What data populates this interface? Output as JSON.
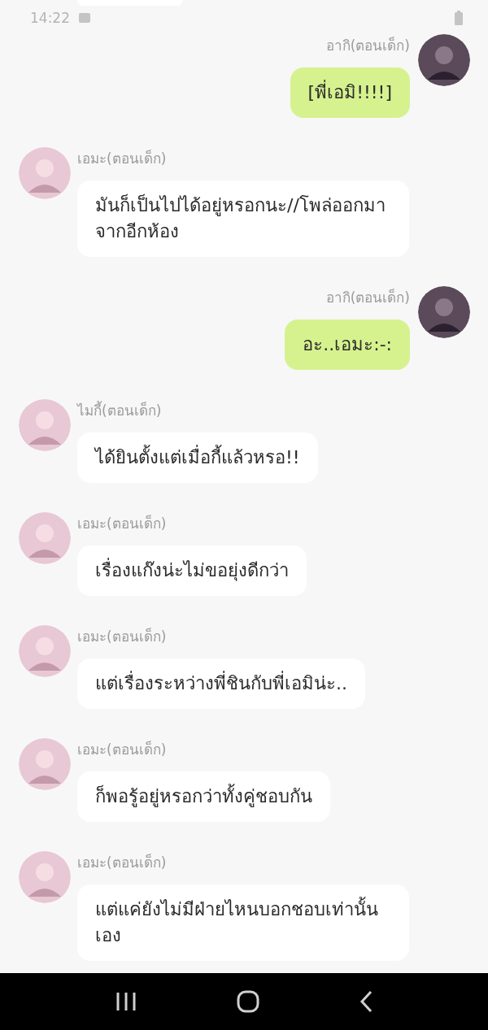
{
  "status_bar": {
    "time": "14:22"
  },
  "messages": [
    {
      "kind": "outgoing",
      "sender": "อากิ(ตอนเด็ก)",
      "text": "[พี่เอมิ!!!!]"
    },
    {
      "kind": "incoming",
      "sender": "เอมะ(ตอนเด็ก)",
      "text": "มันก็เป็นไปได้อยู่หรอกนะ//โพล่ออกมาจากอีกห้อง"
    },
    {
      "kind": "outgoing",
      "sender": "อากิ(ตอนเด็ก)",
      "text": "อะ..เอมะ:-:"
    },
    {
      "kind": "incoming",
      "sender": "ไมกี้(ตอนเด็ก)",
      "text": "ได้ยินตั้งแต่เมื่อกี้แล้วหรอ!!"
    },
    {
      "kind": "incoming",
      "sender": "เอมะ(ตอนเด็ก)",
      "text": "เรื่องแก๊งน่ะไม่ขอยุ่งดีกว่า"
    },
    {
      "kind": "incoming",
      "sender": "เอมะ(ตอนเด็ก)",
      "text": "แต่เรื่องระหว่างพี่ชินกับพี่เอมิน่ะ.."
    },
    {
      "kind": "incoming",
      "sender": "เอมะ(ตอนเด็ก)",
      "text": "ก็พอรู้อยู่หรอกว่าทั้งคู่ชอบกัน"
    },
    {
      "kind": "incoming",
      "sender": "เอมะ(ตอนเด็ก)",
      "text": "แต่แค่ยังไม่มีฝ่ายไหนบอกชอบเท่านั้นเอง"
    }
  ]
}
